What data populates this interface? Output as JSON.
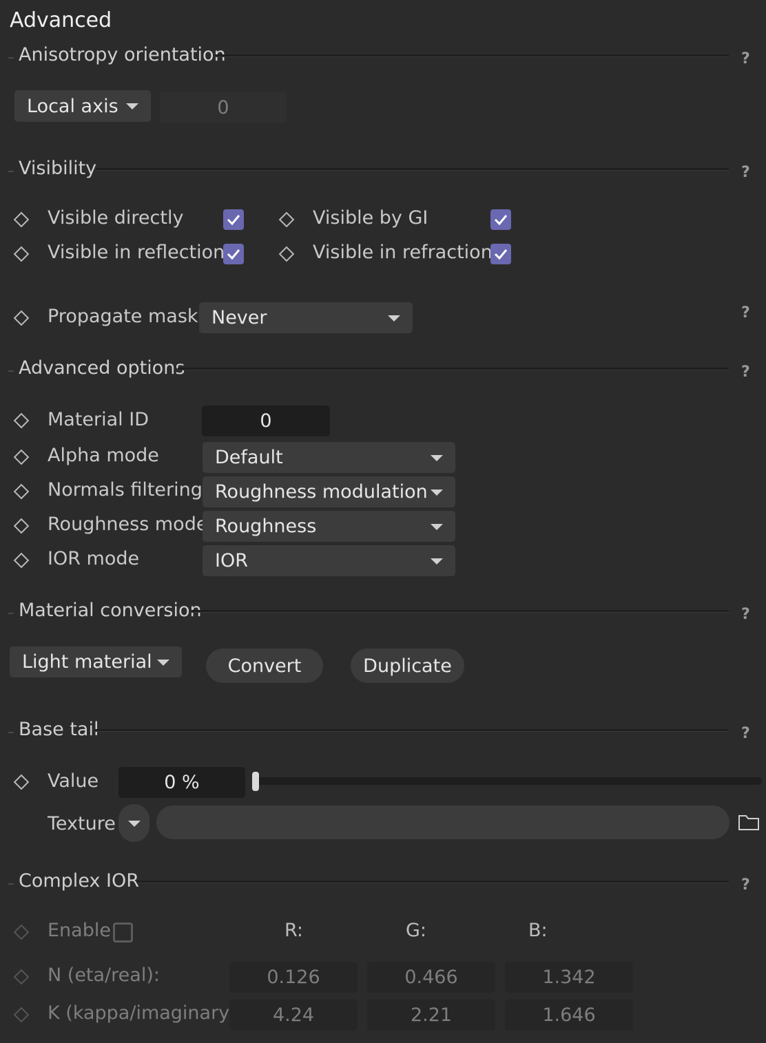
{
  "title": "Advanced",
  "anisotropy": {
    "section": "Anisotropy orientation",
    "mode": "Local axis",
    "value": "0"
  },
  "visibility": {
    "section": "Visibility",
    "visible_directly": "Visible directly",
    "visible_by_gi": "Visible by GI",
    "visible_in_reflections": "Visible in reflections",
    "visible_in_refractions": "Visible in refractions",
    "propagate_masks_label": "Propagate masks",
    "propagate_masks_value": "Never"
  },
  "advanced_options": {
    "section": "Advanced options",
    "material_id_label": "Material ID",
    "material_id_value": "0",
    "alpha_mode_label": "Alpha mode",
    "alpha_mode_value": "Default",
    "normals_filtering_label": "Normals filtering",
    "normals_filtering_value": "Roughness modulation",
    "roughness_mode_label": "Roughness mode",
    "roughness_mode_value": "Roughness",
    "ior_mode_label": "IOR mode",
    "ior_mode_value": "IOR"
  },
  "material_conversion": {
    "section": "Material conversion",
    "type": "Light material",
    "convert": "Convert",
    "duplicate": "Duplicate"
  },
  "base_tail": {
    "section": "Base tail",
    "value_label": "Value",
    "value": "0 %",
    "slider_fraction": 0,
    "texture_label": "Texture"
  },
  "complex_ior": {
    "section": "Complex IOR",
    "enable_label": "Enable",
    "col_r": "R:",
    "col_g": "G:",
    "col_b": "B:",
    "n_label": "N (eta/real):",
    "n_values": [
      "0.126",
      "0.466",
      "1.342"
    ],
    "k_label": "K (kappa/imaginary):",
    "k_values": [
      "4.24",
      "2.21",
      "1.646"
    ]
  },
  "help_glyph": "?",
  "colors": {
    "background": "#2b2b2b",
    "checkbox_checked": "#6a68b0",
    "field_dark": "#1e1e1e",
    "dropdown_bg": "#3c3c3c"
  }
}
